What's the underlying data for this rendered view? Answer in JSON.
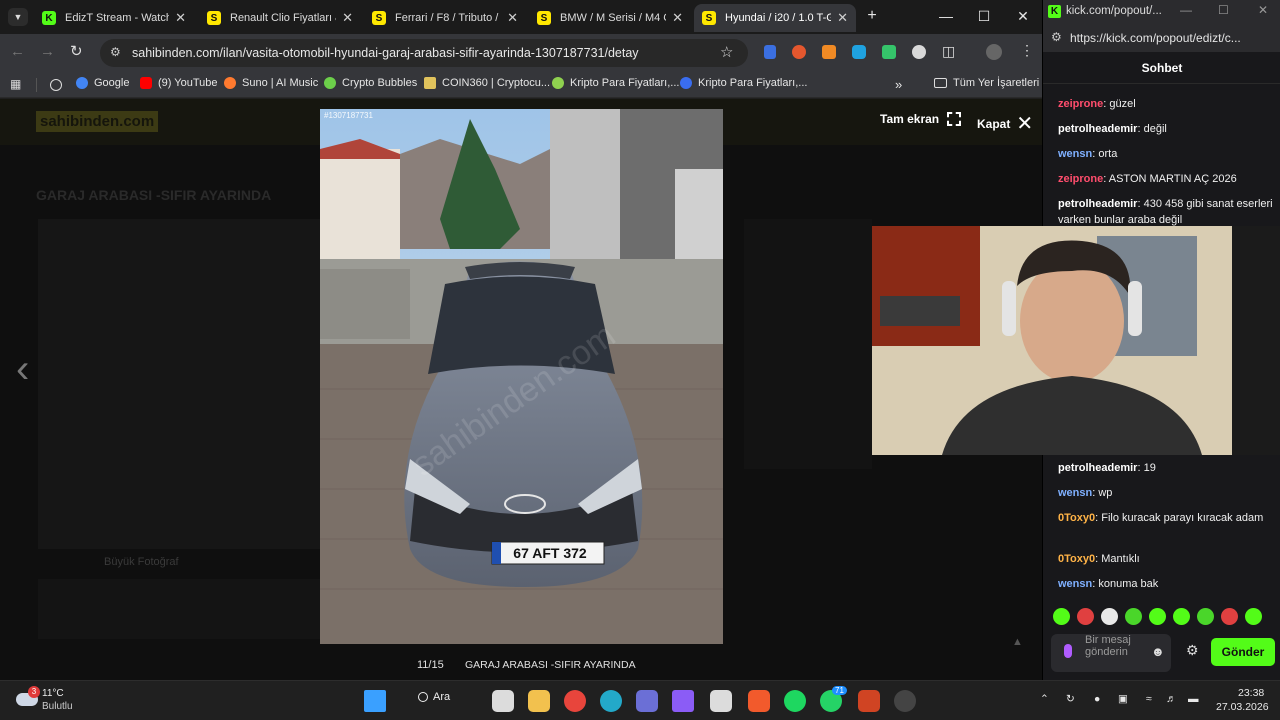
{
  "browser": {
    "tabs": [
      {
        "label": "EdizT Stream - Watch Li",
        "favicon": "K",
        "favicon_color": "#53fc18"
      },
      {
        "label": "Renault Clio Fiyatları &",
        "favicon": "S",
        "favicon_color": "#ffe800"
      },
      {
        "label": "Ferrari / F8 / Tributo / Fi",
        "favicon": "S",
        "favicon_color": "#ffe800"
      },
      {
        "label": "BMW / M Serisi / M4 Co",
        "favicon": "S",
        "favicon_color": "#ffe800"
      },
      {
        "label": "Hyundai / i20 / 1.0 T-GD",
        "favicon": "S",
        "favicon_color": "#ffe800"
      }
    ],
    "url": "sahibinden.com/ilan/vasita-otomobil-hyundai-garaj-arabasi-sifir-ayarinda-1307187731/detay",
    "bookmarks": [
      {
        "label": "Google",
        "color": "#4285f4"
      },
      {
        "label": "(9) YouTube",
        "color": "#ff0000"
      },
      {
        "label": "Suno | AI Music",
        "color": "#ff7a2f"
      },
      {
        "label": "Crypto Bubbles",
        "color": "#6ccf4a"
      },
      {
        "label": "COIN360 | Cryptocu...",
        "color": "#e0c25c"
      },
      {
        "label": "Kripto Para Fiyatları,...",
        "color": "#8fd14f"
      },
      {
        "label": "Kripto Para Fiyatları,...",
        "color": "#3a6df0"
      }
    ],
    "bookmarks_folder": "Tüm Yer İşaretleri"
  },
  "listing_bg": {
    "logo": "sahibinden.com",
    "title": "GARAJ ARABASI -SIFIR AYARINDA",
    "big_photo": "Büyük Fotoğraf"
  },
  "lightbox": {
    "photo_id": "#1307187731",
    "fullscreen_label": "Tam ekran",
    "close_label": "Kapat",
    "counter": "11/15",
    "caption": "GARAJ ARABASI -SIFIR AYARINDA",
    "plate": "67 AFT 372",
    "watermark": "sahibinden.com"
  },
  "kick": {
    "window_title": "kick.com/popout/...",
    "url": "https://kick.com/popout/edizt/c...",
    "chat_title": "Sohbet",
    "messages_top": [
      {
        "user": "zeiprone",
        "color": "#ff4d6d",
        "text": "güzel"
      },
      {
        "user": "petrolheademir",
        "color": "#ffffff",
        "text": "değil"
      },
      {
        "user": "wensn",
        "color": "#7fb0ff",
        "text": "orta"
      },
      {
        "user": "zeiprone",
        "color": "#ff4d6d",
        "text": "ASTON MARTIN AÇ 2026"
      },
      {
        "user": "petrolheademir",
        "color": "#ffffff",
        "text": "430 458 gibi sanat eserleri varken bunlar araba değil"
      }
    ],
    "messages_bottom": [
      {
        "user": "petrolheademir",
        "color": "#ffffff",
        "text": "19"
      },
      {
        "user": "wensn",
        "color": "#7fb0ff",
        "text": "wp"
      },
      {
        "user": "0Toxy0",
        "color": "#ffb347",
        "text": "Filo kuracak parayı kıracak adam"
      },
      {
        "user": "0Toxy0",
        "color": "#ffb347",
        "text": "Mantıklı"
      },
      {
        "user": "wensn",
        "color": "#7fb0ff",
        "text": "konuma bak"
      }
    ],
    "input_placeholder": "Bir mesaj gönderin",
    "send_label": "Gönder"
  },
  "taskbar": {
    "weather_temp": "11°C",
    "weather_desc": "Bulutlu",
    "weather_badge": "3",
    "search_label": "Ara",
    "whatsapp_badge": "71",
    "time": "23:38",
    "date": "27.03.2026"
  },
  "colors": {
    "kick_green": "#53fc18",
    "sahibinden_yellow": "#ffe800"
  }
}
